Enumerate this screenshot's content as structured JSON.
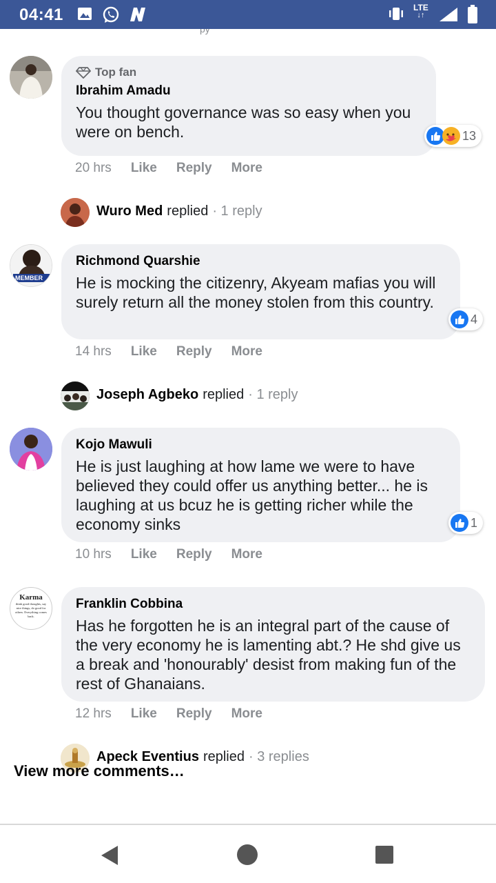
{
  "status_bar": {
    "time": "04:41",
    "network": "LTE"
  },
  "colors": {
    "status_bar_bg": "#3b5797",
    "bubble_bg": "#eff0f3",
    "like_blue": "#1877f2",
    "meta_gray": "#8a8d91"
  },
  "comments": [
    {
      "badge": "Top fan",
      "author": "Ibrahim Amadu",
      "text": "You thought governance was so easy when you were on bench.",
      "time": "20 hrs",
      "like": "Like",
      "reply": "Reply",
      "more": "More",
      "reaction_count": "13",
      "reactions": [
        "like-icon",
        "care-icon"
      ]
    },
    {
      "author": "Richmond Quarshie",
      "text": "He is mocking the citizenry, Akyeam mafias you will surely return all the money stolen from this country.",
      "time": "14 hrs",
      "like": "Like",
      "reply": "Reply",
      "more": "More",
      "reaction_count": "4",
      "reactions": [
        "like-icon"
      ]
    },
    {
      "author": "Kojo Mawuli",
      "text": "He is just laughing at how lame we were to have believed they could offer us anything better... he is laughing at us bcuz he is getting richer while the economy sinks",
      "time": "10 hrs",
      "like": "Like",
      "reply": "Reply",
      "more": "More",
      "reaction_count": "1",
      "reactions": [
        "like-icon"
      ]
    },
    {
      "author": "Franklin Cobbina",
      "text": "Has he forgotten he is an integral part of the cause of the very economy he is lamenting abt.? He shd give us a break and 'honourably' desist from making fun of the rest of Ghanaians.",
      "time": "12 hrs",
      "like": "Like",
      "reply": "Reply",
      "more": "More"
    }
  ],
  "replies": [
    {
      "name": "Wuro Med",
      "verb": "replied",
      "count": "· 1 reply"
    },
    {
      "name": "Joseph Agbeko",
      "verb": "replied",
      "count": "· 1 reply"
    },
    {
      "name": "Apeck Eventius",
      "verb": "replied",
      "count": "· 3 replies"
    }
  ],
  "avatar_text": {
    "richmond": "MEMBER",
    "franklin_title": "Karma",
    "franklin_body": "think good thoughts, say nice things, do good for others. Everything comes back."
  },
  "view_more": "View more comments…"
}
